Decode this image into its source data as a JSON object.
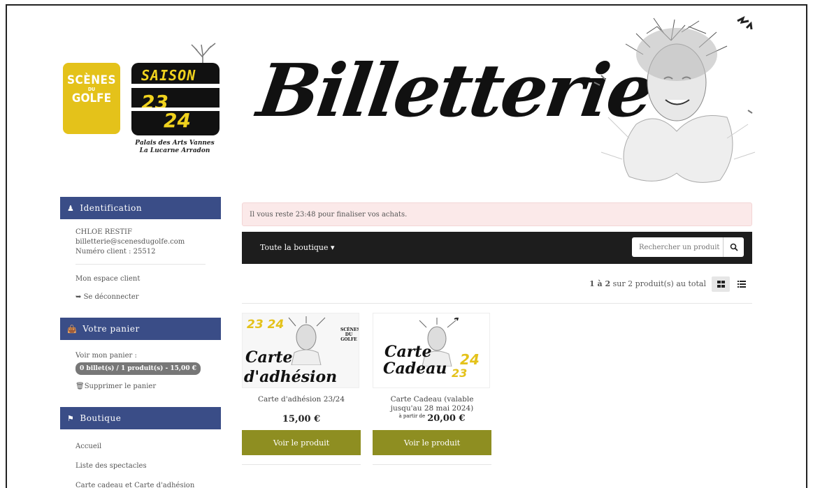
{
  "header": {
    "logo_left": {
      "line1": "SCÈNES",
      "line2": "GOLFE",
      "prefix": "DU"
    },
    "logo_saison": {
      "word": "SAISON",
      "year1": "23",
      "year2": "24"
    },
    "logo_places": [
      "Palais des Arts Vannes",
      "La Lucarne Arradon"
    ],
    "title": "Billetterie"
  },
  "sidebar": {
    "identification": {
      "title": "Identification",
      "name": "CHLOE RESTIF",
      "email": "billetterie@scenesdugolfe.com",
      "client": "Numéro client : 25512",
      "space_link": "Mon espace client",
      "logout_link": "Se déconnecter"
    },
    "cart": {
      "title": "Votre panier",
      "view_label": "Voir mon panier :",
      "badge": "0 billet(s) / 1 produit(s) - 15,00 €",
      "delete_link": "Supprimer le panier"
    },
    "shop": {
      "title": "Boutique",
      "items": [
        "Accueil",
        "Liste des spectacles",
        "Carte cadeau et Carte d'adhésion"
      ]
    }
  },
  "main": {
    "alert": "Il vous reste 23:48 pour finaliser vos achats.",
    "nav_shop": "Toute la boutique",
    "search_placeholder": "Rechercher un produit",
    "count_bold": "1 à 2",
    "count_rest": " sur 2 produit(s) au total",
    "products": [
      {
        "name": "Carte d'adhésion 23/24",
        "price": "15,00 €",
        "price_prefix": "",
        "button": "Voir le produit",
        "img_title1": "Carte",
        "img_title2": "d'adhésion",
        "img_year": "23 24",
        "img_logo": "SCÈNES DU GOLFE"
      },
      {
        "name": "Carte Cadeau (valable jusqu'au 28 mai 2024)",
        "price": "20,00 €",
        "price_prefix": "à partir de",
        "button": "Voir le produit",
        "img_title1": "Carte",
        "img_title2": "Cadeau",
        "img_year1": "24",
        "img_year2": "23"
      }
    ]
  },
  "colors": {
    "sidebar_header": "#3a4d87",
    "button": "#8e8e21",
    "navbar": "#1d1d1d",
    "alert_bg": "#fbe9e9",
    "logo_yellow": "#e4c21a"
  },
  "icons": [
    "user-icon",
    "shopping-bag-icon",
    "tag-icon",
    "logout-icon",
    "trash-icon",
    "search-icon",
    "grid-view-icon",
    "list-view-icon",
    "caret-down-icon"
  ]
}
